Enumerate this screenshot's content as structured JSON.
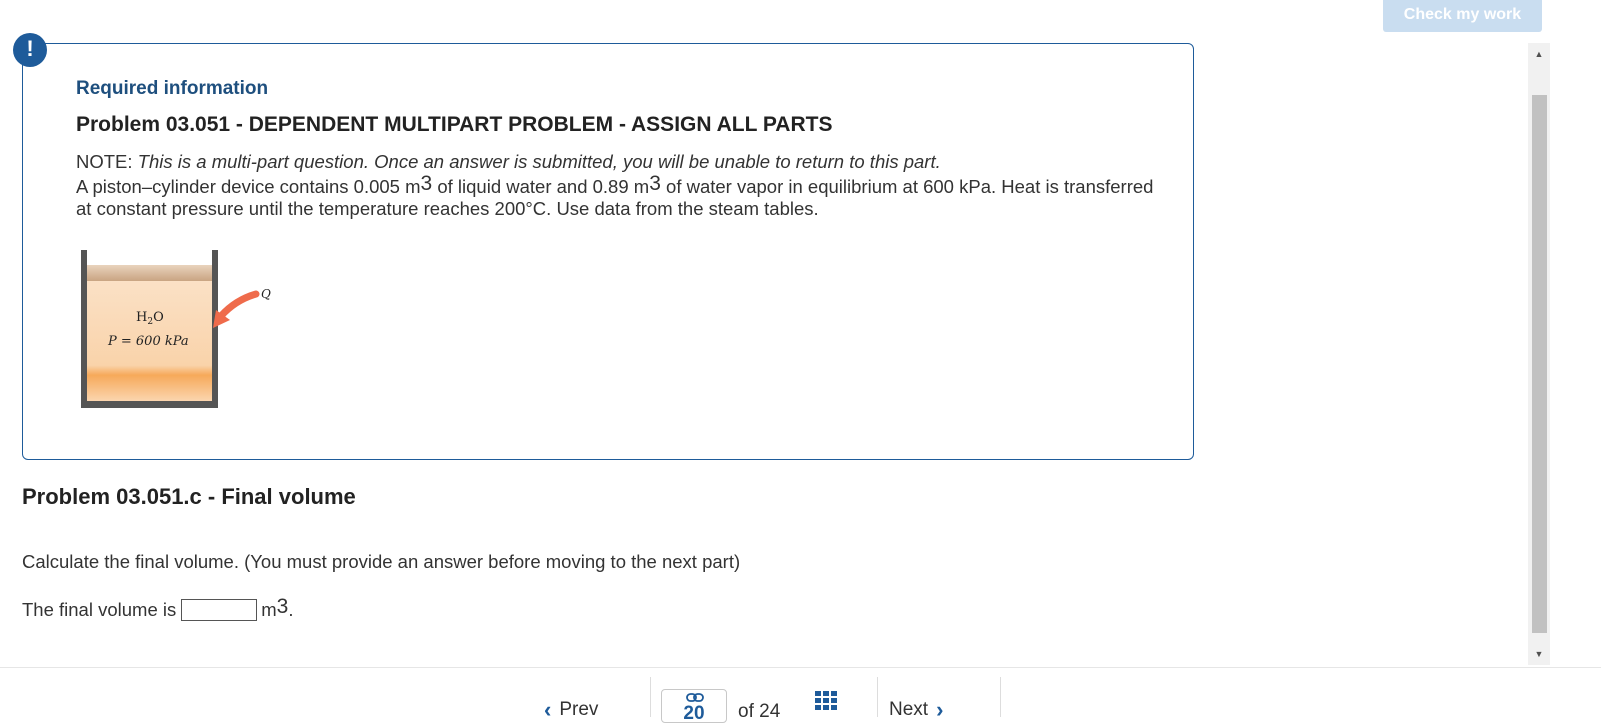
{
  "header": {
    "check_button": "Check my work",
    "alert_symbol": "!"
  },
  "info": {
    "required_label": "Required information",
    "problem_title": "Problem 03.051 - DEPENDENT MULTIPART PROBLEM - ASSIGN ALL PARTS",
    "note_label": "NOTE:",
    "note_text": "This is a multi-part question. Once an answer is submitted, you will be unable to return to this part.",
    "desc_1": "A piston–cylinder device contains 0.005 m",
    "desc_exp_1": "3",
    "desc_2": " of liquid water and 0.89 m",
    "desc_exp_2": "3",
    "desc_3": " of water vapor in equilibrium at 600 kPa. Heat is transferred at constant pressure until the temperature reaches 200°C. Use data from the steam tables."
  },
  "figure": {
    "substance_main": "H",
    "substance_sub": "2",
    "substance_end": "O",
    "pressure_label": "P = 600 kPa",
    "heat_label": "Q",
    "colors": {
      "piston": "#d9b99b",
      "fluid_top": "#f9d6b5",
      "fluid_bottom": "#f7b36b",
      "arrow": "#ef6b4b",
      "wall": "#555555"
    }
  },
  "part": {
    "title": "Problem 03.051.c - Final volume",
    "instruction": "Calculate the final volume. (You must provide an answer before moving to the next part)",
    "answer_prefix": "The final volume is",
    "answer_value": "",
    "unit": "m",
    "unit_exp": "3",
    "unit_suffix": "."
  },
  "pager": {
    "prev_label": "Prev",
    "current_page": "20",
    "of_label": "of",
    "total_pages": "24",
    "next_label": "Next"
  },
  "colors": {
    "accent": "#1e5b9a",
    "check_button_bg": "#c9ddf0"
  }
}
